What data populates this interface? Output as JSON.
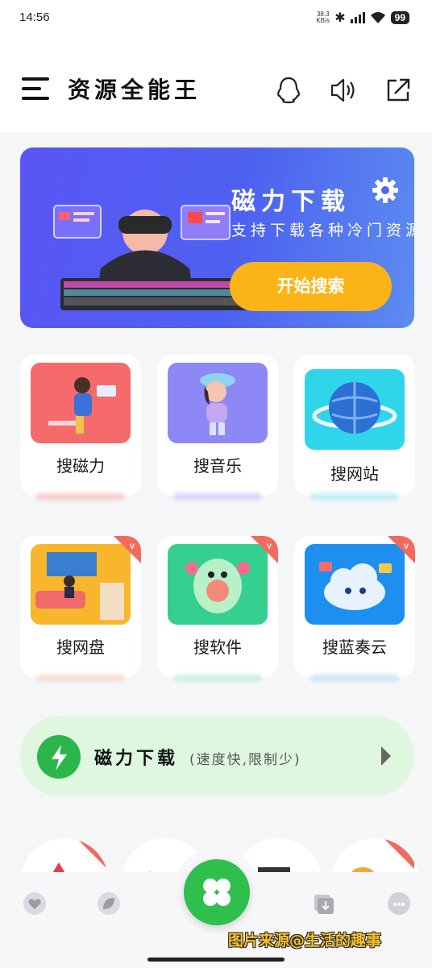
{
  "status_bar": {
    "time": "14:56",
    "net_speed_value": "38.3",
    "net_speed_unit": "KB/s",
    "battery": "99",
    "icons": [
      "bluetooth-icon",
      "signal-icon",
      "wifi-icon",
      "battery-icon"
    ]
  },
  "header": {
    "title": "资源全能王",
    "icons": [
      "menu-icon",
      "qq-icon",
      "speaker-icon",
      "share-icon"
    ]
  },
  "banner": {
    "title": "磁力下载",
    "subtitle": "支持下载各种冷门资源",
    "button": "开始搜索",
    "accent": "#fbb417"
  },
  "tiles": [
    {
      "label": "搜磁力",
      "vip": false,
      "color": "#f56b6b",
      "glow": "#f8a5a5"
    },
    {
      "label": "搜音乐",
      "vip": false,
      "color": "#8d88f6",
      "glow": "#b9b4fa"
    },
    {
      "label": "搜网站",
      "vip": false,
      "color": "#2fd6ea",
      "glow": "#8fe7f3"
    },
    {
      "label": "搜网盘",
      "vip": true,
      "color": "#f7b62c",
      "glow": "#f9c7b0"
    },
    {
      "label": "搜软件",
      "vip": true,
      "color": "#35cf8f",
      "glow": "#a9e9cb"
    },
    {
      "label": "搜蓝奏云",
      "vip": true,
      "color": "#1c8ff0",
      "glow": "#a9d4f8"
    }
  ],
  "vip_badge": "VIP",
  "download_bar": {
    "name": "磁力下载",
    "note": "(速度快,限制少)"
  },
  "bottom_nav": {
    "icons": [
      "heart-icon",
      "leaf-icon",
      "clover-icon",
      "download-box-icon",
      "chat-icon"
    ]
  },
  "watermark": "图片来源@生活的趣事"
}
